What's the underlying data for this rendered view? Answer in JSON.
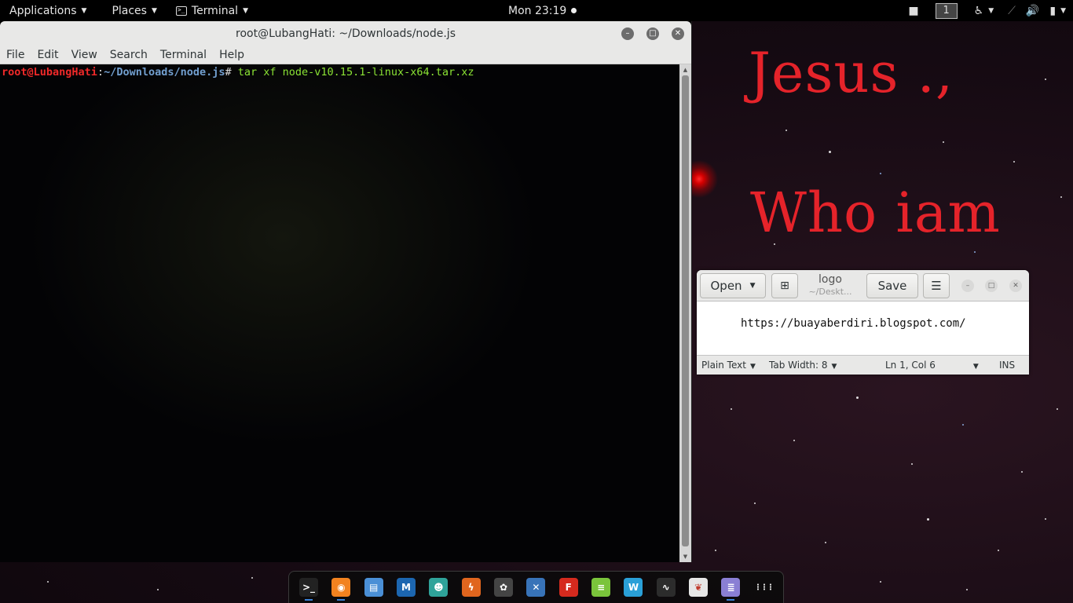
{
  "topbar": {
    "applications": "Applications",
    "places": "Places",
    "terminal": "Terminal",
    "clock": "Mon 23:19",
    "workspace": "1"
  },
  "terminal": {
    "title": "root@LubangHati: ~/Downloads/node.js",
    "menu": [
      "File",
      "Edit",
      "View",
      "Search",
      "Terminal",
      "Help"
    ],
    "prompt_user": "root@LubangHati",
    "prompt_sep": ":",
    "prompt_path": "~/Downloads/node.js",
    "prompt_hash": "#",
    "command": " tar xf node-v10.15.1-linux-x64.tar.xz"
  },
  "wallpaper": {
    "line1": "Jesus .,",
    "line2": "Who iam"
  },
  "gedit": {
    "open": "Open",
    "title": "logo",
    "subtitle": "~/Deskt...",
    "save": "Save",
    "content": "https://buayaberdiri.blogspot.com/",
    "status": {
      "language": "Plain Text",
      "tab_width": "Tab Width: 8",
      "position": "Ln 1, Col 6",
      "mode": "INS"
    }
  },
  "dock": {
    "apps": [
      {
        "name": "terminal-app-icon",
        "color": "#222222",
        "glyph": ">_",
        "running": true
      },
      {
        "name": "firefox-app-icon",
        "color": "#f2821f",
        "glyph": "◉",
        "running": true
      },
      {
        "name": "files-app-icon",
        "color": "#4a8fd6",
        "glyph": "▤",
        "running": false
      },
      {
        "name": "metasploit-app-icon",
        "color": "#1c66b0",
        "glyph": "M",
        "running": false
      },
      {
        "name": "armitage-app-icon",
        "color": "#2fa39a",
        "glyph": "☻",
        "running": false
      },
      {
        "name": "burpsuite-app-icon",
        "color": "#e0651e",
        "glyph": "ϟ",
        "running": false
      },
      {
        "name": "beef-app-icon",
        "color": "#444444",
        "glyph": "✿",
        "running": false
      },
      {
        "name": "maltego-app-icon",
        "color": "#3873b8",
        "glyph": "✕",
        "running": false
      },
      {
        "name": "faraday-app-icon",
        "color": "#d52a1e",
        "glyph": "F",
        "running": false
      },
      {
        "name": "leafpad-app-icon",
        "color": "#7ac43b",
        "glyph": "≡",
        "running": false
      },
      {
        "name": "wireshark-app-icon",
        "color": "#2aa0d8",
        "glyph": "W",
        "running": false
      },
      {
        "name": "system-monitor-app-icon",
        "color": "#2c2c2c",
        "glyph": "∿",
        "running": false
      },
      {
        "name": "cherrytree-app-icon",
        "color": "#e6e6e6",
        "glyph": "❦",
        "running": false
      },
      {
        "name": "gedit-app-icon",
        "color": "#8a7fd4",
        "glyph": "≣",
        "running": true
      },
      {
        "name": "show-applications-icon",
        "color": "transparent",
        "glyph": "⋮⋮⋮",
        "running": false
      }
    ]
  }
}
